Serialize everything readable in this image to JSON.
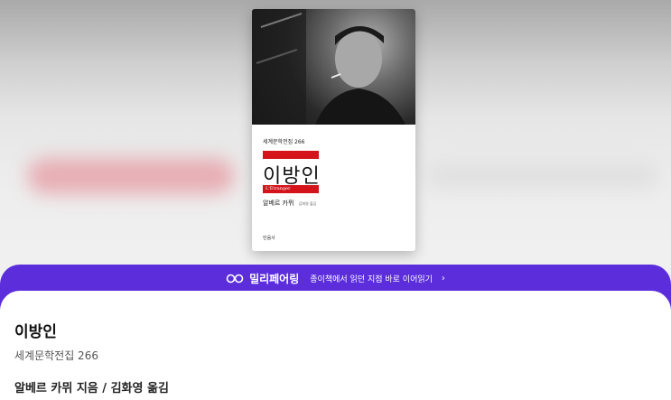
{
  "cover": {
    "series_label": "세계문학전집 266",
    "title": "이방인",
    "original_title": "L'Étranger",
    "author": "알베르 카뮈",
    "translator": "김화영 옮김",
    "publisher": "민음사"
  },
  "banner": {
    "brand": "밀리페어링",
    "subtitle": "종이책에서 읽던 지점 바로 이어읽기",
    "chevron": "›",
    "color": "#5b2ddb"
  },
  "book": {
    "title": "이방인",
    "series": "세계문학전집 266",
    "authors": "알베르 카뮈 지음 / 김화영 옮김"
  },
  "colors": {
    "accent_red": "#d4131b",
    "banner_purple": "#5b2ddb"
  }
}
